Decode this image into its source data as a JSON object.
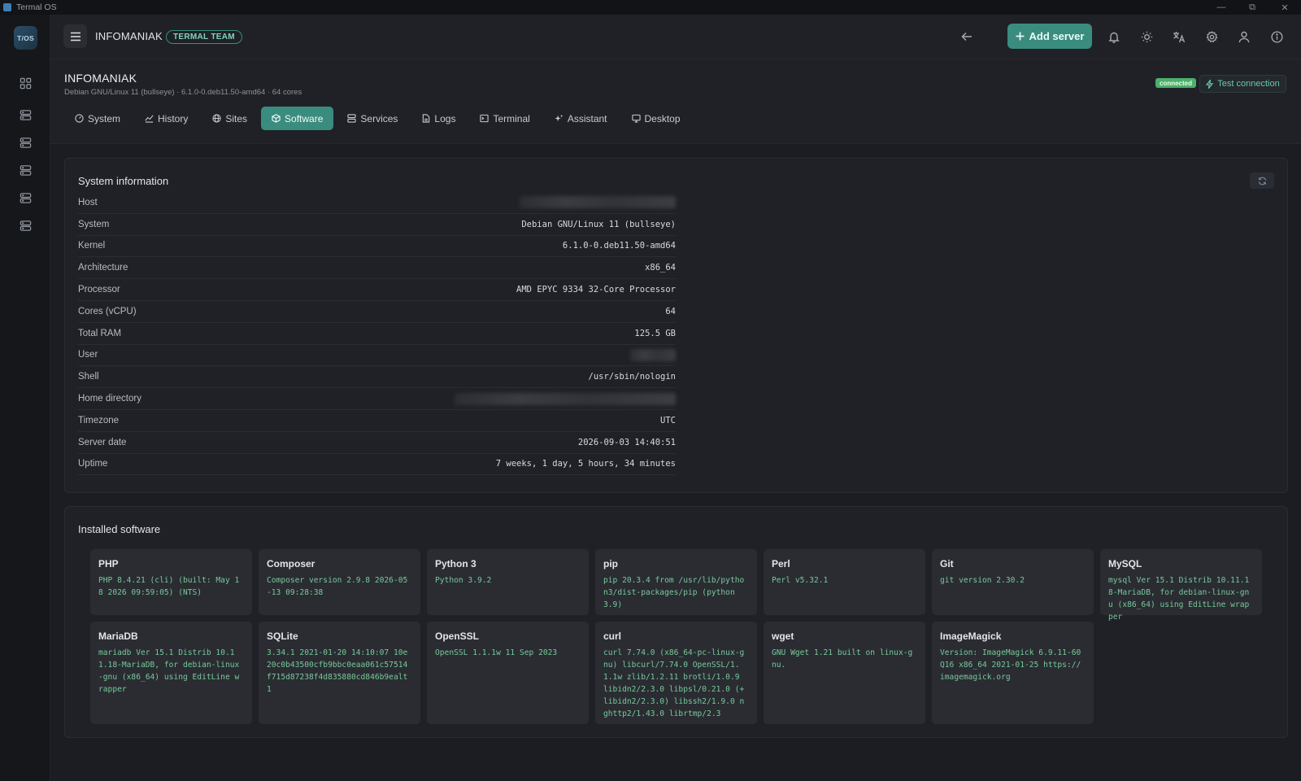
{
  "window": {
    "title": "Termal OS"
  },
  "rail": {
    "logo_text": "T/OS"
  },
  "header": {
    "org_name": "INFOMANIAK",
    "team_badge": "TERMAL TEAM",
    "add_server_label": "Add server"
  },
  "server": {
    "name": "INFOMANIAK",
    "subtitle": "Debian GNU/Linux 11 (bullseye) · 6.1.0-0.deb11.50-amd64 · 64 cores",
    "status_badge": "connected",
    "test_connection_label": "Test connection"
  },
  "tabs": [
    {
      "label": "System",
      "icon": "dashboard-icon"
    },
    {
      "label": "History",
      "icon": "chart-line-icon"
    },
    {
      "label": "Sites",
      "icon": "globe-icon"
    },
    {
      "label": "Software",
      "icon": "package-icon",
      "active": true
    },
    {
      "label": "Services",
      "icon": "database-icon"
    },
    {
      "label": "Logs",
      "icon": "file-icon"
    },
    {
      "label": "Terminal",
      "icon": "terminal-icon"
    },
    {
      "label": "Assistant",
      "icon": "sparkle-icon"
    },
    {
      "label": "Desktop",
      "icon": "monitor-icon"
    }
  ],
  "system_info": {
    "title": "System information",
    "rows": [
      {
        "label": "Host",
        "value": "",
        "redacted": true
      },
      {
        "label": "System",
        "value": "Debian GNU/Linux 11 (bullseye)"
      },
      {
        "label": "Kernel",
        "value": "6.1.0-0.deb11.50-amd64"
      },
      {
        "label": "Architecture",
        "value": "x86_64"
      },
      {
        "label": "Processor",
        "value": "AMD EPYC 9334 32-Core Processor"
      },
      {
        "label": "Cores (vCPU)",
        "value": "64"
      },
      {
        "label": "Total RAM",
        "value": "125.5 GB"
      },
      {
        "label": "User",
        "value": "",
        "redacted": true
      },
      {
        "label": "Shell",
        "value": "/usr/sbin/nologin"
      },
      {
        "label": "Home directory",
        "value": "",
        "redacted": true
      },
      {
        "label": "Timezone",
        "value": "UTC"
      },
      {
        "label": "Server date",
        "value": "2026-09-03 14:40:51"
      },
      {
        "label": "Uptime",
        "value": "7 weeks, 1 day, 5 hours, 34 minutes"
      }
    ]
  },
  "software": {
    "title": "Installed software",
    "items": [
      {
        "name": "PHP",
        "version": "PHP 8.4.21 (cli) (built: May 18 2026 09:59:05) (NTS)"
      },
      {
        "name": "Composer",
        "version": "Composer version 2.9.8 2026-05-13 09:28:38"
      },
      {
        "name": "Python 3",
        "version": "Python 3.9.2"
      },
      {
        "name": "pip",
        "version": "pip 20.3.4 from /usr/lib/python3/dist-packages/pip (python 3.9)"
      },
      {
        "name": "Perl",
        "version": "Perl v5.32.1"
      },
      {
        "name": "Git",
        "version": "git version 2.30.2"
      },
      {
        "name": "MySQL",
        "version": "mysql Ver 15.1 Distrib 10.11.18-MariaDB, for debian-linux-gnu (x86_64) using EditLine wrapper"
      },
      {
        "name": "MariaDB",
        "version": "mariadb Ver 15.1 Distrib 10.11.18-MariaDB, for debian-linux-gnu (x86_64) using EditLine wrapper"
      },
      {
        "name": "SQLite",
        "version": "3.34.1 2021-01-20 14:10:07 10e20c0b43500cfb9bbc0eaa061c57514f715d87238f4d835880cd846b9ealt1"
      },
      {
        "name": "OpenSSL",
        "version": "OpenSSL 1.1.1w 11 Sep 2023"
      },
      {
        "name": "curl",
        "version": "curl 7.74.0 (x86_64-pc-linux-gnu) libcurl/7.74.0 OpenSSL/1.1.1w zlib/1.2.11 brotli/1.0.9 libidn2/2.3.0 libpsl/0.21.0 (+libidn2/2.3.0) libssh2/1.9.0 nghttp2/1.43.0 librtmp/2.3"
      },
      {
        "name": "wget",
        "version": "GNU Wget 1.21 built on linux-gnu."
      },
      {
        "name": "ImageMagick",
        "version": "Version: ImageMagick 6.9.11-60 Q16 x86_64 2021-01-25 https://imagemagick.org"
      }
    ]
  },
  "colors": {
    "accent": "#3a8c7f",
    "status_ok": "#4caf6a",
    "version_text": "#78c99a"
  }
}
